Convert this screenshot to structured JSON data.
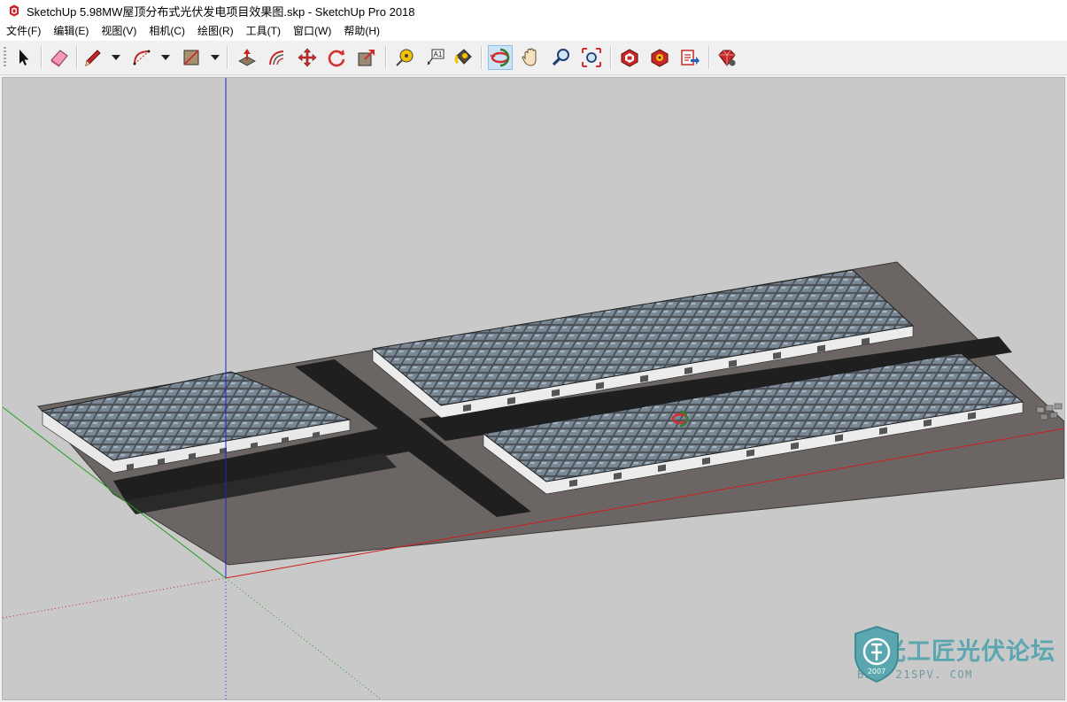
{
  "window": {
    "title": "SketchUp 5.98MW屋顶分布式光伏发电项目效果图.skp - SketchUp Pro 2018",
    "icon": "sketchup-logo-icon"
  },
  "menu": [
    "文件(F)",
    "编辑(E)",
    "视图(V)",
    "相机(C)",
    "绘图(R)",
    "工具(T)",
    "窗口(W)",
    "帮助(H)"
  ],
  "toolbar": {
    "tools": [
      {
        "name": "select-tool-icon"
      },
      {
        "name": "eraser-tool-icon"
      },
      {
        "name": "pencil-line-tool-icon"
      },
      {
        "name": "arc-tool-icon"
      },
      {
        "name": "rectangle-shape-tool-icon"
      },
      {
        "name": "push-pull-tool-icon"
      },
      {
        "name": "offset-tool-icon"
      },
      {
        "name": "move-tool-icon"
      },
      {
        "name": "rotate-tool-icon"
      },
      {
        "name": "scale-tool-icon"
      },
      {
        "name": "tape-measure-tool-icon"
      },
      {
        "name": "text-tool-icon"
      },
      {
        "name": "paint-bucket-tool-icon"
      },
      {
        "name": "orbit-tool-icon"
      },
      {
        "name": "pan-tool-icon"
      },
      {
        "name": "zoom-tool-icon"
      },
      {
        "name": "zoom-extents-tool-icon"
      },
      {
        "name": "3d-warehouse-icon"
      },
      {
        "name": "extension-warehouse-icon"
      },
      {
        "name": "send-to-layout-icon"
      },
      {
        "name": "extension-manager-icon"
      }
    ],
    "active_tool": "orbit-tool-icon",
    "text_tool_glyph": "A1"
  },
  "viewport": {
    "background_color": "#c9c9c9",
    "ground_color": "#6b6663",
    "road_color": "#1f1f1f",
    "axis_colors": {
      "red": "#cc2020",
      "green": "#20a020",
      "blue": "#2020cc"
    }
  },
  "watermark": {
    "main": "阳光工匠光伏论坛",
    "sub": "BBS. 21SPV. COM",
    "year": "2007",
    "color": "#5ba7b0"
  }
}
